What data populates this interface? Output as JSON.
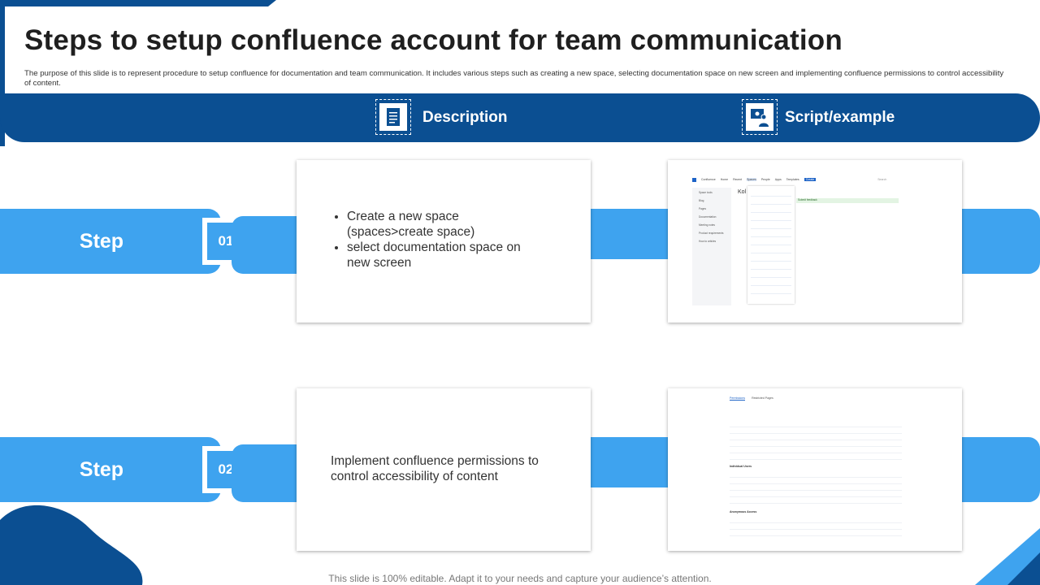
{
  "slide": {
    "title": "Steps to setup confluence account for team communication",
    "subtitle": "The purpose of this slide is to represent procedure to setup confluence for documentation and team communication.  It includes various steps such as creating a new space, selecting documentation space on new screen and implementing  confluence permissions to control accessibility of content."
  },
  "header": {
    "description_label": "Description",
    "script_label": "Script/example"
  },
  "steps": [
    {
      "label": "Step",
      "number": "01",
      "bullets": [
        "Create a new space (spaces>create space)",
        "select documentation space on new screen"
      ]
    },
    {
      "label": "Step",
      "number": "02",
      "text": "Implement confluence permissions to control accessibility of content"
    }
  ],
  "screenshot1": {
    "brand": "Confluence",
    "nav": [
      "Home",
      "Recent",
      "Spaces",
      "People",
      "Apps",
      "Templates"
    ],
    "create_button": "Create",
    "search_placeholder": "Search",
    "page_heading": "Kol",
    "banner": "Submit feedback",
    "sidebar_items": [
      "Space tools",
      "Blog",
      "Pages",
      "Documentation",
      "Meeting notes",
      "Product requirements",
      "How-to articles"
    ]
  },
  "screenshot2": {
    "tabs": [
      "Permissions",
      "Restricted Pages"
    ],
    "sections": [
      "Individual Users",
      "Anonymous Access"
    ]
  },
  "footer": "This slide is 100% editable. Adapt it to your needs and capture your audience’s attention.",
  "colors": {
    "navy": "#0b4f92",
    "step_blue": "#3ea3ef"
  }
}
